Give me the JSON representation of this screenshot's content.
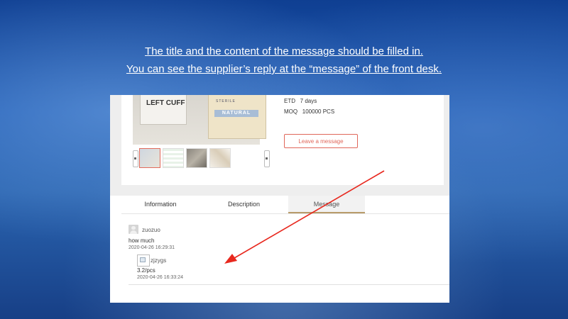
{
  "instructions": {
    "line1": "The title and the content of the message should be filled in.",
    "line2": "You can see the supplier’s reply at the “message” of the front desk."
  },
  "product": {
    "cuff_label": "LEFT CUFF",
    "pack_sterile": "STERILE",
    "pack_label": "NATURAL",
    "etd_label": "ETD",
    "etd_value": "7 days",
    "moq_label": "MOQ",
    "moq_value": "100000 PCS",
    "leave_message_button": "Leave a message"
  },
  "tabs": {
    "information": "Information",
    "description": "Description",
    "message": "Message",
    "active": "message"
  },
  "message": {
    "user": "zuozuo",
    "question": "how much",
    "question_time": "2020-04-26 16:29:31",
    "supplier": "zjzygs",
    "reply": "3.2/pcs",
    "reply_time": "2020-04-26 16:33:24"
  },
  "colors": {
    "accent_red": "#e0675a",
    "arrow_red": "#e8281e",
    "tab_underline": "#b89b6a"
  },
  "icons": {
    "avatar": "user-avatar-icon",
    "supplier_image": "broken-image-icon",
    "arrow": "red-pointer-arrow"
  }
}
